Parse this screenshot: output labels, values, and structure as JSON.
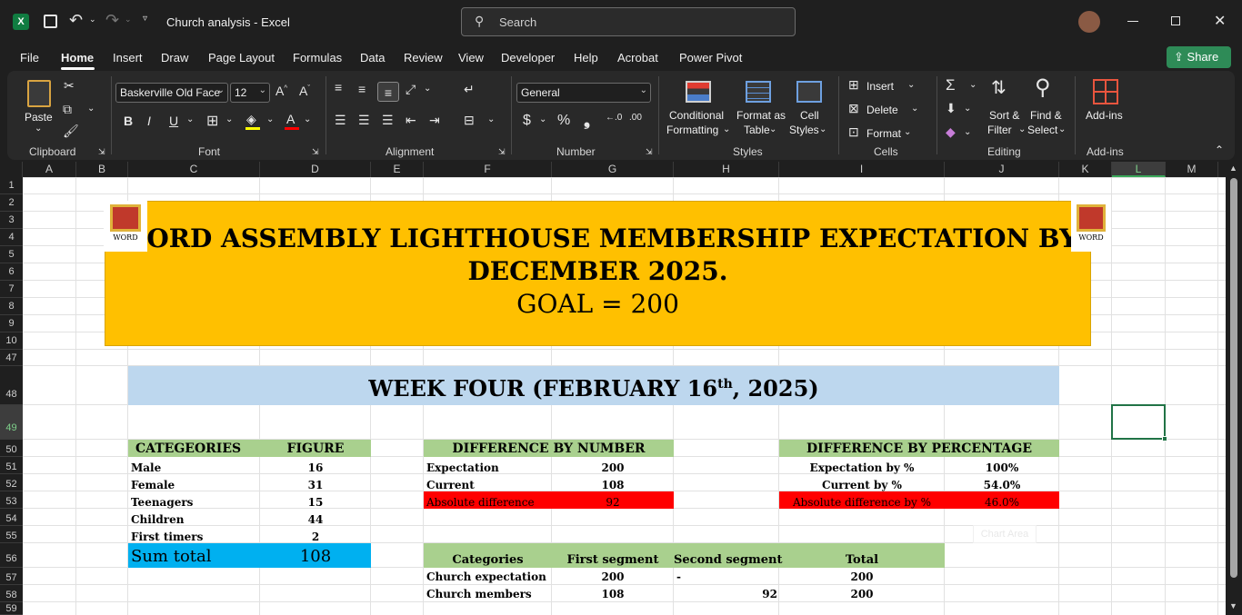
{
  "window": {
    "title": "Church analysis",
    "app": "Excel",
    "search_placeholder": "Search"
  },
  "menu": {
    "items": [
      "File",
      "Home",
      "Insert",
      "Draw",
      "Page Layout",
      "Formulas",
      "Data",
      "Review",
      "View",
      "Developer",
      "Help",
      "Acrobat",
      "Power Pivot"
    ],
    "share": "Share"
  },
  "ribbon": {
    "clipboard": {
      "paste": "Paste",
      "label": "Clipboard"
    },
    "font": {
      "name": "Baskerville Old Face",
      "size": "12",
      "label": "Font"
    },
    "alignment": {
      "label": "Alignment"
    },
    "number": {
      "format": "General",
      "label": "Number"
    },
    "styles": {
      "cond1": "Conditional",
      "cond2": "Formatting",
      "fmt1": "Format as",
      "fmt2": "Table",
      "cell1": "Cell",
      "cell2": "Styles",
      "label": "Styles"
    },
    "cells": {
      "insert": "Insert",
      "delete": "Delete",
      "format": "Format",
      "label": "Cells"
    },
    "editing": {
      "sort1": "Sort &",
      "sort2": "Filter",
      "find1": "Find &",
      "find2": "Select",
      "label": "Editing"
    },
    "addins": {
      "btn": "Add-ins",
      "label": "Add-ins"
    }
  },
  "columns": [
    "A",
    "B",
    "C",
    "D",
    "E",
    "F",
    "G",
    "H",
    "I",
    "J",
    "K",
    "L",
    "M"
  ],
  "rows": [
    "1",
    "2",
    "3",
    "4",
    "5",
    "6",
    "7",
    "8",
    "9",
    "10",
    "47",
    "48",
    "49",
    "50",
    "51",
    "52",
    "53",
    "54",
    "55",
    "56",
    "57",
    "58",
    "59"
  ],
  "sheet": {
    "banner_line1": "WORD ASSEMBLY LIGHTHOUSE MEMBERSHIP EXPECTATION BY",
    "banner_line2": "DECEMBER 2025.",
    "banner_line3": "GOAL = 200",
    "logo_text": "WORD",
    "week_pre": "WEEK FOUR (FEBRUARY 16",
    "week_sup": "th",
    "week_post": ", 2025)",
    "cat": {
      "h1": "CATEGEORIES",
      "h2": "FIGURE",
      "rows": [
        [
          "Male",
          "16"
        ],
        [
          "Female",
          "31"
        ],
        [
          "Teenagers",
          "15"
        ],
        [
          "Children",
          "44"
        ],
        [
          "First timers",
          "2"
        ]
      ],
      "sum_label": "Sum total",
      "sum_value": "108"
    },
    "num": {
      "header": "DIFFERENCE BY NUMBER",
      "rows": [
        [
          "Expectation",
          "200"
        ],
        [
          "Current",
          "108"
        ],
        [
          "Absolute difference",
          "92"
        ]
      ]
    },
    "pct": {
      "header": "DIFFERENCE BY PERCENTAGE",
      "rows": [
        [
          "Expectation by %",
          "100%"
        ],
        [
          "Current by %",
          "54.0%"
        ],
        [
          "Absolute difference by %",
          "46.0%"
        ]
      ]
    },
    "seg": {
      "headers": [
        "Categories",
        "First segment",
        "Second segment",
        "Total"
      ],
      "rows": [
        [
          "Church expectation",
          "200",
          "-",
          "",
          "200"
        ],
        [
          "Church members",
          "108",
          "",
          "92",
          "200"
        ]
      ]
    },
    "chart_area": "Chart Area"
  },
  "colors": {
    "banner": "#FFC000",
    "week": "#BDD7EE",
    "green": "#A9D08E",
    "red": "#FF0000",
    "cyan": "#00B0F0",
    "share": "#2E8B57"
  }
}
